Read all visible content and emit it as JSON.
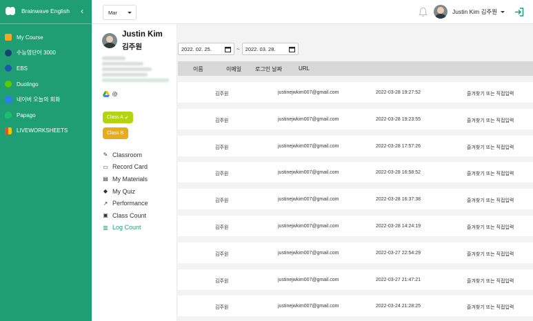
{
  "app": {
    "brand": "Brainwave English"
  },
  "sidebar": {
    "items": [
      {
        "label": "My Course",
        "icon": "book-icon",
        "color": "#f5a623"
      },
      {
        "label": "수능영단어 3000",
        "icon": "globe-icon",
        "color": "#1c3f73"
      },
      {
        "label": "EBS",
        "icon": "ebs-icon",
        "color": "#1a5aa8"
      },
      {
        "label": "Duolingo",
        "icon": "owl-icon",
        "color": "#58cc02"
      },
      {
        "label": "네이버 오늘의 회화",
        "icon": "conversation-icon",
        "color": "#2b7de9"
      },
      {
        "label": "Papago",
        "icon": "papago-icon",
        "color": "#1bbf6b"
      },
      {
        "label": "LIVEWORKSHEETS",
        "icon": "worksheet-icon",
        "color": "#e94e3c"
      }
    ]
  },
  "header": {
    "month": "Mar",
    "user_name": "Justin Kim 김주원"
  },
  "profile": {
    "name_en": "Justin Kim",
    "name_ko": "김주원",
    "classes": [
      {
        "label": "Class A",
        "color": "#b3d40f",
        "checked": true
      },
      {
        "label": "Class B",
        "color": "#e6ac1b",
        "checked": false
      }
    ],
    "menu": [
      {
        "label": "Classroom",
        "icon": "edit-icon",
        "active": false
      },
      {
        "label": "Record Card",
        "icon": "card-icon",
        "active": false
      },
      {
        "label": "My Materials",
        "icon": "folder-icon",
        "active": false
      },
      {
        "label": "My Quiz",
        "icon": "graduation-cap-icon",
        "active": false
      },
      {
        "label": "Performance",
        "icon": "chart-line-icon",
        "active": false
      },
      {
        "label": "Class Count",
        "icon": "image-icon",
        "active": false
      },
      {
        "label": "Log Count",
        "icon": "chart-bar-icon",
        "active": true
      }
    ]
  },
  "filters": {
    "date_from": "2022. 02. 25.",
    "date_to": "2022. 03. 28.",
    "separator": "~"
  },
  "table": {
    "columns": [
      "이름",
      "이메일",
      "로그인 날짜",
      "URL"
    ],
    "rows": [
      {
        "name": "김주원",
        "email": "justinejwkim007@gmail.com",
        "time": "2022-03-28 19:27:52",
        "url": "즐겨찾기 또는 직접입력"
      },
      {
        "name": "김주원",
        "email": "justinejwkim007@gmail.com",
        "time": "2022-03-28 19:23:55",
        "url": "즐겨찾기 또는 직접입력"
      },
      {
        "name": "김주원",
        "email": "justinejwkim007@gmail.com",
        "time": "2022-03-28 17:57:26",
        "url": "즐겨찾기 또는 직접입력"
      },
      {
        "name": "김주원",
        "email": "justinejwkim007@gmail.com",
        "time": "2022-03-28 16:58:52",
        "url": "즐겨찾기 또는 직접입력"
      },
      {
        "name": "김주원",
        "email": "justinejwkim007@gmail.com",
        "time": "2022-03-28 16:37:38",
        "url": "즐겨찾기 또는 직접입력"
      },
      {
        "name": "김주원",
        "email": "justinejwkim007@gmail.com",
        "time": "2022-03-28 14:24:19",
        "url": "즐겨찾기 또는 직접입력"
      },
      {
        "name": "김주원",
        "email": "justinejwkim007@gmail.com",
        "time": "2022-03-27 22:54:29",
        "url": "즐겨찾기 또는 직접입력"
      },
      {
        "name": "김주원",
        "email": "justinejwkim007@gmail.com",
        "time": "2022-03-27 21:47:21",
        "url": "즐겨찾기 또는 직접입력"
      },
      {
        "name": "김주원",
        "email": "justinejwkim007@gmail.com",
        "time": "2022-03-24 21:28:25",
        "url": "즐겨찾기 또는 직접입력"
      }
    ]
  },
  "colors": {
    "brand_green": "#1e9e72",
    "active_menu": "#1e9e72"
  }
}
